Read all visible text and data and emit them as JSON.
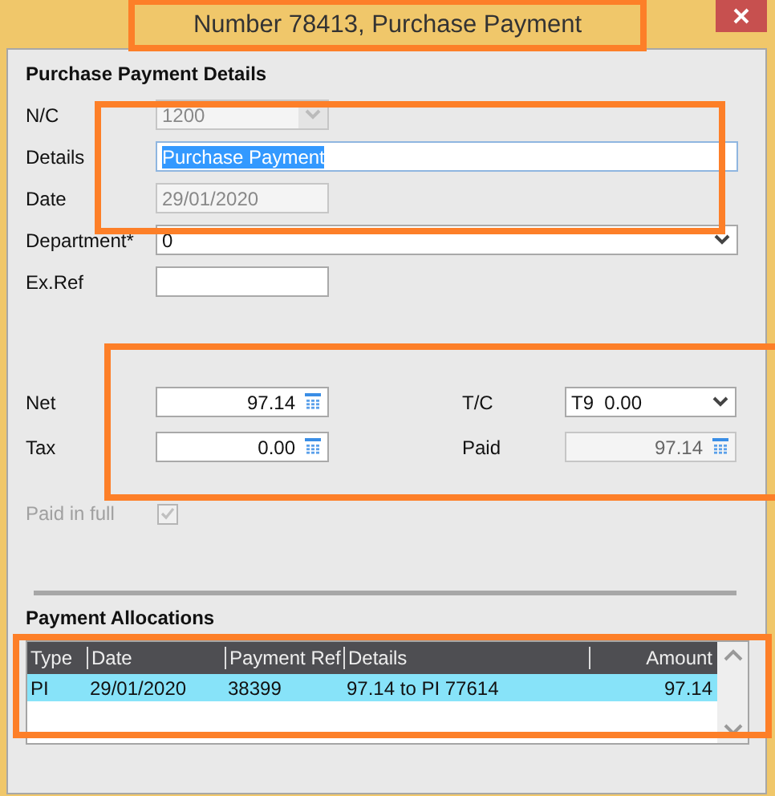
{
  "window": {
    "title": "Number 78413, Purchase Payment",
    "highlighted": true
  },
  "details": {
    "heading": "Purchase Payment Details",
    "primary": {
      "highlighted": true,
      "fields": [
        {
          "label": "N/C",
          "kind": "combo",
          "value": "1200",
          "disabled": true,
          "text_selected": false
        },
        {
          "label": "Details",
          "kind": "text",
          "value": "Purchase Payment",
          "disabled": false,
          "text_selected": true
        },
        {
          "label": "Date",
          "kind": "text",
          "value": "29/01/2020",
          "disabled": true,
          "text_selected": false
        }
      ]
    },
    "other_fields": [
      {
        "label": "Department*",
        "kind": "combo",
        "value": "0",
        "disabled": false,
        "text_selected": false
      },
      {
        "label": "Ex.Ref",
        "kind": "text",
        "disabled": false,
        "text_selected": false
      }
    ]
  },
  "amounts": {
    "highlighted": true,
    "fields": [
      {
        "label": "Net",
        "kind": "amount",
        "value": "97.14",
        "disabled": false
      },
      {
        "label": "T/C",
        "kind": "combo",
        "value": "T9  0.00",
        "disabled": false
      },
      {
        "label": "Tax",
        "kind": "amount",
        "value": "0.00",
        "disabled": false
      },
      {
        "label": "Paid",
        "kind": "amount",
        "value": "97.14",
        "disabled": true
      }
    ]
  },
  "paid_in_full": {
    "label": "Paid in full",
    "checked": true,
    "disabled": true
  },
  "allocations": {
    "heading": "Payment Allocations",
    "highlighted": true,
    "columns": [
      "Type",
      "Date",
      "Payment Ref",
      "Details",
      "Amount"
    ],
    "rows": [
      {
        "cells": [
          "PI",
          "29/01/2020",
          "38399",
          "97.14 to PI 77614",
          "97.14"
        ],
        "selected": true
      }
    ]
  }
}
